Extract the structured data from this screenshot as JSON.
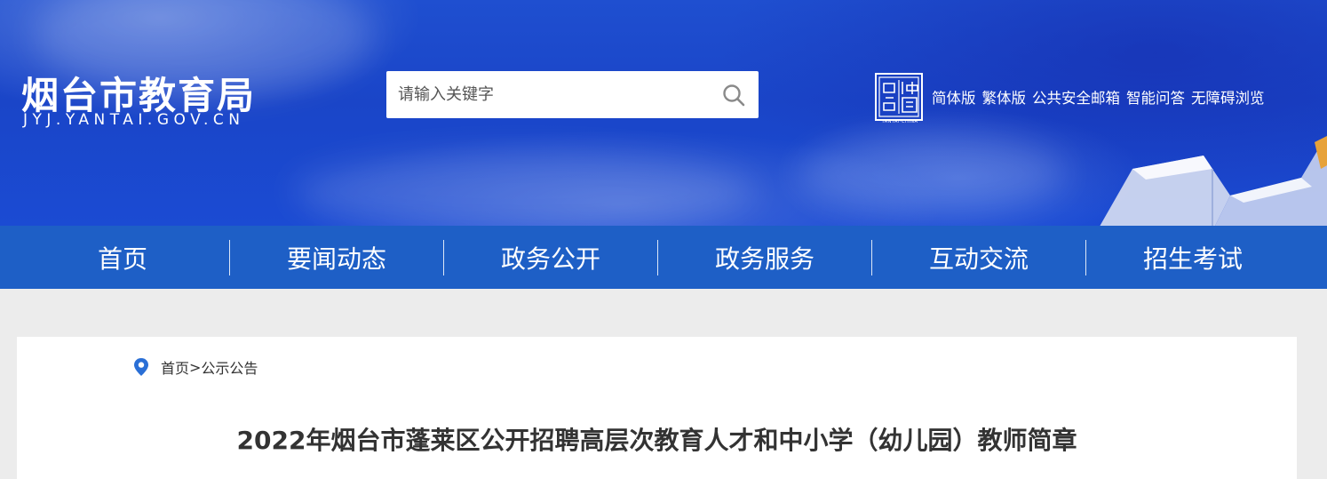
{
  "site": {
    "title": "烟台市教育局",
    "domain": "JYJ.YANTAI.GOV.CN"
  },
  "search": {
    "placeholder": "请输入关键字",
    "value": ""
  },
  "seal": {
    "label": "YANTAI·CHINA"
  },
  "top_links": [
    {
      "label": "简体版"
    },
    {
      "label": "繁体版"
    },
    {
      "label": "公共安全邮箱"
    },
    {
      "label": "智能问答"
    },
    {
      "label": "无障碍浏览"
    }
  ],
  "nav": {
    "items": [
      {
        "label": "首页"
      },
      {
        "label": "要闻动态"
      },
      {
        "label": "政务公开"
      },
      {
        "label": "政务服务"
      },
      {
        "label": "互动交流"
      },
      {
        "label": "招生考试"
      }
    ]
  },
  "breadcrumb": {
    "home": "首页",
    "separator": ">",
    "current": "公示公告"
  },
  "article": {
    "title": "2022年烟台市蓬莱区公开招聘高层次教育人才和中小学（幼儿园）教师简章"
  },
  "colors": {
    "banner": "#1b4bd3",
    "nav": "#1e5fc6",
    "page_bg": "#ececec",
    "pin": "#2a6fd6"
  },
  "icons": {
    "search": "search-icon",
    "location": "location-pin-icon",
    "seal": "yantai-seal-icon"
  }
}
